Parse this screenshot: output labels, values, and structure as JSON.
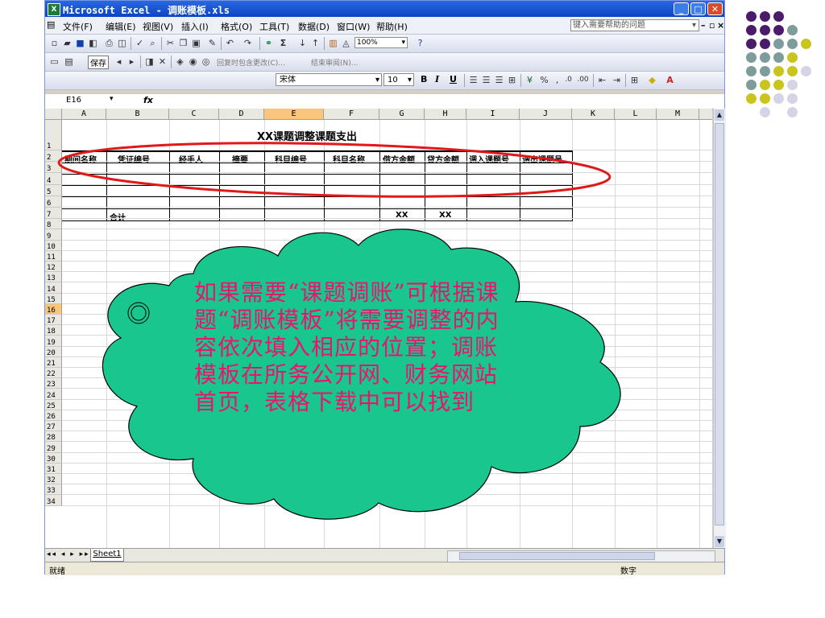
{
  "window": {
    "title": "Microsoft Excel - 调账模板.xls",
    "app_icon": "X"
  },
  "menu": {
    "items": [
      "文件(F)",
      "编辑(E)",
      "视图(V)",
      "插入(I)",
      "格式(O)",
      "工具(T)",
      "数据(D)",
      "窗口(W)",
      "帮助(H)"
    ],
    "help_placeholder": "键入需要帮助的问题"
  },
  "toolbar": {
    "zoom": "100%",
    "save_label": "保存",
    "review_reply": "回复时包含更改(C)...",
    "review_end": "结束审阅(N)...",
    "font": "宋体",
    "font_size": "10"
  },
  "formula_bar": {
    "name_box": "E16",
    "fx": "fx"
  },
  "columns": [
    "A",
    "B",
    "C",
    "D",
    "E",
    "F",
    "G",
    "H",
    "I",
    "J",
    "K",
    "L",
    "M"
  ],
  "selected_column": "E",
  "selected_row": "16",
  "sheet": {
    "title": "XX课题调整课题支出",
    "headers": [
      "期间名称",
      "凭证编号",
      "经手人",
      "摘要",
      "科目编号",
      "科目名称",
      "借方金额",
      "贷方金额",
      "调入课题号",
      "调出课题号"
    ],
    "total_label": "合计",
    "debit_total": "XX",
    "credit_total": "XX"
  },
  "callout": {
    "text": "如果需要“课题调账”可根据课题“调账模板”将需要调整的内容依次填入相应的位置；调账模板在所务公开网、财务网站首页，表格下载中可以找到"
  },
  "tabs": {
    "active": "Sheet1"
  },
  "status": {
    "ready": "就绪",
    "mode": "数字"
  },
  "decor_colors": {
    "purple": "#4b1a6b",
    "teal": "#7f9c9c",
    "yellow": "#c9c41e",
    "lavender": "#d5d3e6"
  }
}
